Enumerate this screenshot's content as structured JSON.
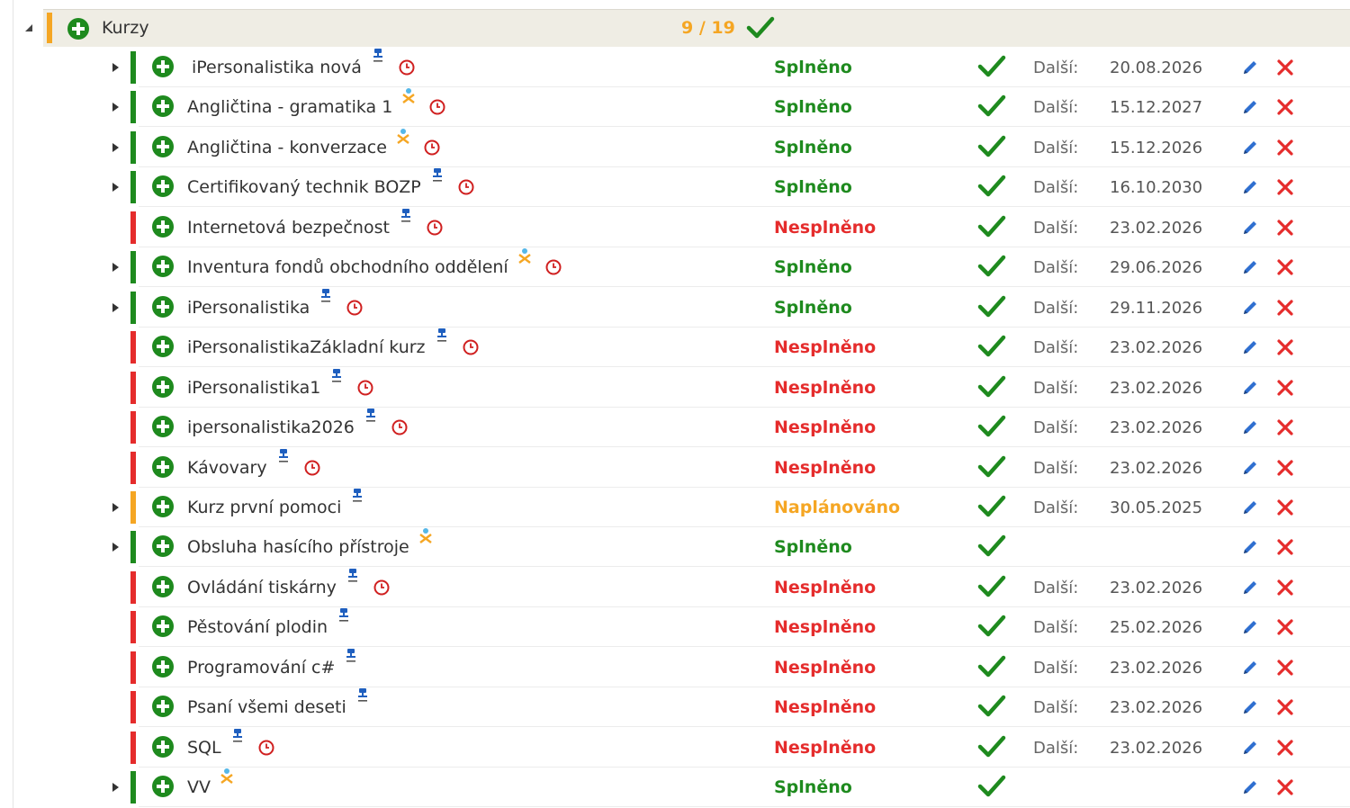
{
  "header": {
    "title": "Kurzy",
    "count": "9 / 19"
  },
  "labels": {
    "next": "Další:"
  },
  "colors": {
    "green": "#1e8a1e",
    "red": "#e52c2c",
    "orange": "#f5a623",
    "blue": "#1f5fbf"
  },
  "courses": [
    {
      "name": "iPersonalistika nová",
      "expandable": true,
      "bar": "green",
      "status": "Splněno",
      "status_color": "green",
      "type_icon": "presenter-icon",
      "clock": true,
      "next": "20.08.2026"
    },
    {
      "name": "Angličtina - gramatika 1",
      "expandable": true,
      "bar": "green",
      "status": "Splněno",
      "status_color": "green",
      "type_icon": "elearning-icon",
      "clock": true,
      "next": "15.12.2027"
    },
    {
      "name": "Angličtina - konverzace",
      "expandable": true,
      "bar": "green",
      "status": "Splněno",
      "status_color": "green",
      "type_icon": "elearning-icon",
      "clock": true,
      "next": "15.12.2026"
    },
    {
      "name": "Certifikovaný technik BOZP",
      "expandable": true,
      "bar": "green",
      "status": "Splněno",
      "status_color": "green",
      "type_icon": "presenter-icon",
      "clock": true,
      "next": "16.10.2030"
    },
    {
      "name": "Internetová bezpečnost",
      "expandable": false,
      "bar": "red",
      "status": "Nesplněno",
      "status_color": "red",
      "type_icon": "presenter-icon",
      "clock": true,
      "next": "23.02.2026"
    },
    {
      "name": "Inventura fondů obchodního oddělení",
      "expandable": true,
      "bar": "green",
      "status": "Splněno",
      "status_color": "green",
      "type_icon": "elearning-icon",
      "clock": true,
      "next": "29.06.2026"
    },
    {
      "name": "iPersonalistika",
      "expandable": true,
      "bar": "green",
      "status": "Splněno",
      "status_color": "green",
      "type_icon": "presenter-icon",
      "clock": true,
      "next": "29.11.2026"
    },
    {
      "name": "iPersonalistikaZákladní kurz",
      "expandable": false,
      "bar": "red",
      "status": "Nesplněno",
      "status_color": "red",
      "type_icon": "presenter-icon",
      "clock": true,
      "next": "23.02.2026"
    },
    {
      "name": "iPersonalistika1",
      "expandable": false,
      "bar": "red",
      "status": "Nesplněno",
      "status_color": "red",
      "type_icon": "presenter-icon",
      "clock": true,
      "next": "23.02.2026"
    },
    {
      "name": "ipersonalistika2026",
      "expandable": false,
      "bar": "red",
      "status": "Nesplněno",
      "status_color": "red",
      "type_icon": "presenter-icon",
      "clock": true,
      "next": "23.02.2026"
    },
    {
      "name": "Kávovary",
      "expandable": false,
      "bar": "red",
      "status": "Nesplněno",
      "status_color": "red",
      "type_icon": "presenter-icon",
      "clock": true,
      "next": "23.02.2026"
    },
    {
      "name": "Kurz první pomoci",
      "expandable": true,
      "bar": "orange",
      "status": "Naplánováno",
      "status_color": "orange",
      "type_icon": "presenter-icon",
      "clock": false,
      "next": "30.05.2025"
    },
    {
      "name": "Obsluha hasícího přístroje",
      "expandable": true,
      "bar": "green",
      "status": "Splněno",
      "status_color": "green",
      "type_icon": "elearning-icon",
      "clock": false,
      "next": ""
    },
    {
      "name": "Ovládání tiskárny",
      "expandable": false,
      "bar": "red",
      "status": "Nesplněno",
      "status_color": "red",
      "type_icon": "presenter-icon",
      "clock": true,
      "next": "23.02.2026"
    },
    {
      "name": "Pěstování plodin",
      "expandable": false,
      "bar": "red",
      "status": "Nesplněno",
      "status_color": "red",
      "type_icon": "presenter-icon",
      "clock": false,
      "next": "25.02.2026"
    },
    {
      "name": "Programování c#",
      "expandable": false,
      "bar": "red",
      "status": "Nesplněno",
      "status_color": "red",
      "type_icon": "presenter-icon",
      "clock": false,
      "next": "23.02.2026"
    },
    {
      "name": "Psaní všemi deseti",
      "expandable": false,
      "bar": "red",
      "status": "Nesplněno",
      "status_color": "red",
      "type_icon": "presenter-icon",
      "clock": false,
      "next": "23.02.2026"
    },
    {
      "name": "SQL",
      "expandable": false,
      "bar": "red",
      "status": "Nesplněno",
      "status_color": "red",
      "type_icon": "presenter-icon",
      "clock": true,
      "next": "23.02.2026"
    },
    {
      "name": "VV",
      "expandable": true,
      "bar": "green",
      "status": "Splněno",
      "status_color": "green",
      "type_icon": "elearning-icon",
      "clock": false,
      "next": ""
    }
  ]
}
